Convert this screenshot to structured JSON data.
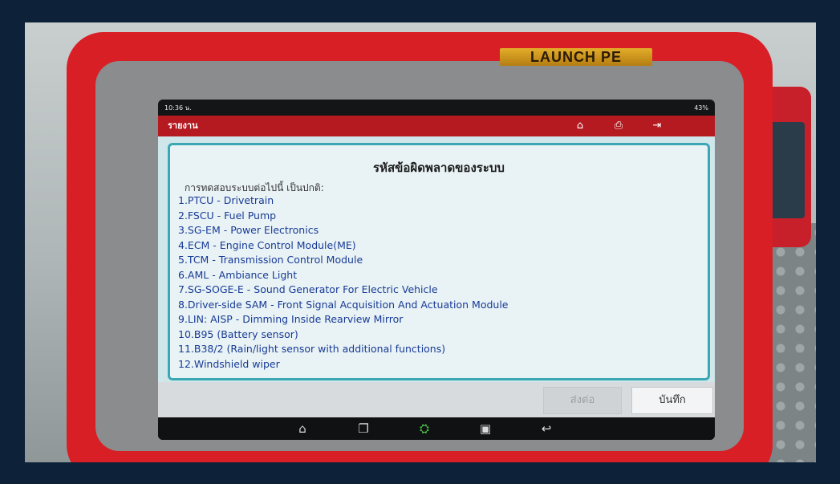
{
  "device": {
    "brand_label": "LAUNCH PE"
  },
  "statusbar": {
    "time": "10:36 น.",
    "battery": "43%"
  },
  "appbar": {
    "title": "รายงาน"
  },
  "report": {
    "heading": "รหัสข้อผิดพลาดของระบบ",
    "intro": "การทดสอบระบบต่อไปนี้ เป็นปกติ:",
    "items": [
      "1.PTCU - Drivetrain",
      "2.FSCU - Fuel Pump",
      "3.SG-EM - Power Electronics",
      "4.ECM - Engine Control Module(ME)",
      "5.TCM - Transmission Control Module",
      "6.AML - Ambiance Light",
      "7.SG-SOGE-E - Sound Generator For Electric Vehicle",
      "8.Driver-side SAM - Front Signal Acquisition And Actuation Module",
      "9.LIN: AISP - Dimming Inside Rearview Mirror",
      "10.B95 (Battery sensor)",
      "11.B38/2 (Rain/light sensor with additional functions)",
      "12.Windshield wiper"
    ]
  },
  "buttons": {
    "send": "ส่งต่อ",
    "save": "บันทึก"
  },
  "icons": {
    "home": "home-icon",
    "print": "print-icon",
    "exit": "exit-icon",
    "nav_home": "android-home-icon",
    "nav_recent": "recent-apps-icon",
    "nav_vci": "vci-connector-icon",
    "nav_gallery": "gallery-icon",
    "nav_back": "back-icon"
  },
  "colors": {
    "accent": "#b41a20",
    "panel_border": "#3aa8b4",
    "list_text": "#173a96",
    "active_icon": "#4fc34a"
  }
}
